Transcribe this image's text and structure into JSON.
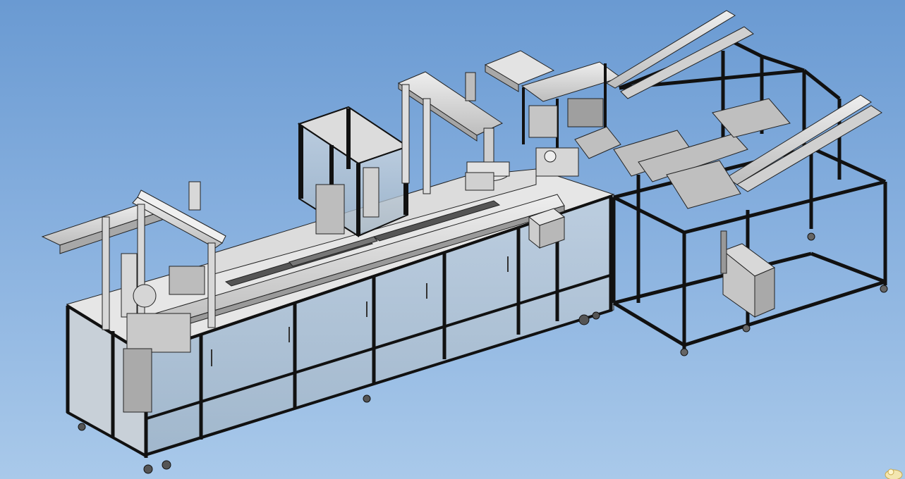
{
  "viewport": {
    "background_top": "#6a9ad2",
    "background_bottom": "#a9c9ea"
  },
  "model": {
    "frame_color": "#1c1c1c",
    "part_color": "#d9d9d9",
    "panel_color": "#b8c6d2",
    "edge_color": "#222222"
  },
  "icons": {
    "corner_logo": "watermark-logo-icon"
  }
}
